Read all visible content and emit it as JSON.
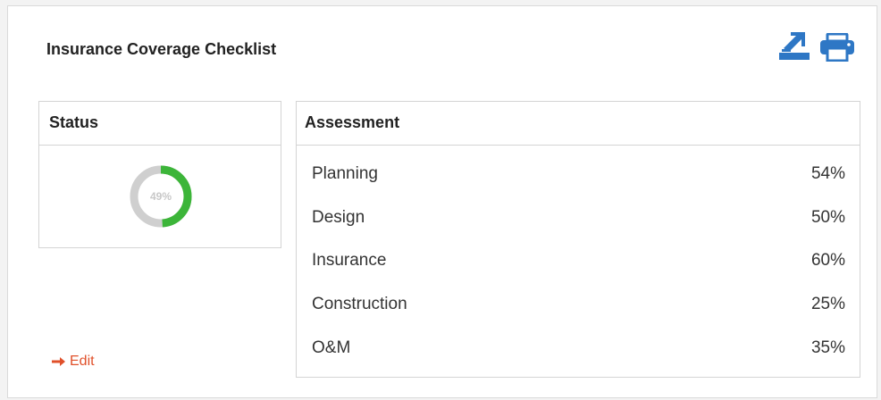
{
  "card": {
    "title": "Insurance Coverage Checklist"
  },
  "toolbar": {
    "export_icon": "export-icon",
    "print_icon": "print-icon",
    "icon_color": "#2e77c5"
  },
  "status": {
    "heading": "Status",
    "percent_label": "49%",
    "fraction": 0.49,
    "fill_color": "#3cb539",
    "track_color": "#cfcfcf"
  },
  "assessment": {
    "heading": "Assessment",
    "rows": [
      {
        "label": "Planning",
        "value": "54%"
      },
      {
        "label": "Design",
        "value": "50%"
      },
      {
        "label": "Insurance",
        "value": "60%"
      },
      {
        "label": "Construction",
        "value": "25%"
      },
      {
        "label": "O&M",
        "value": "35%"
      }
    ]
  },
  "edit": {
    "label": "Edit",
    "icon": "arrow-right-icon",
    "color": "#e0502a"
  }
}
